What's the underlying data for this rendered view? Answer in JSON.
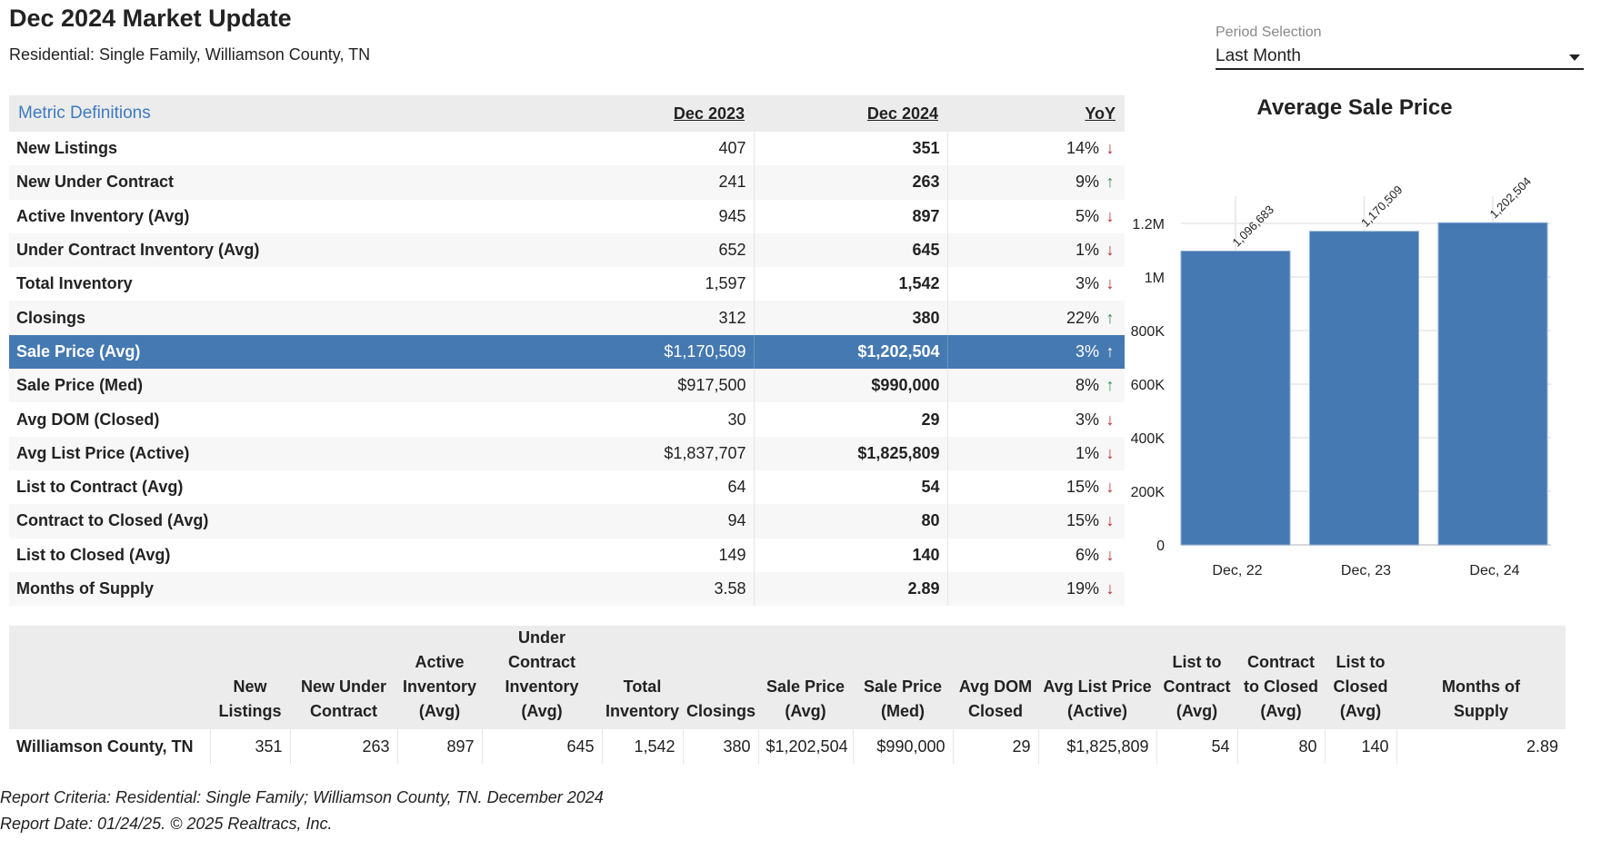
{
  "header": {
    "title": "Dec 2024 Market Update",
    "subtitle": "Residential: Single Family, Williamson County, TN"
  },
  "period_selection": {
    "label": "Period Selection",
    "value": "Last Month"
  },
  "metrics_table": {
    "definitions_link": "Metric Definitions",
    "columns": [
      "Dec 2023",
      "Dec 2024",
      "YoY"
    ],
    "selected_row": 6,
    "rows": [
      {
        "name": "New Listings",
        "prev": "407",
        "curr": "351",
        "yoy": "14%",
        "dir": "down"
      },
      {
        "name": "New Under Contract",
        "prev": "241",
        "curr": "263",
        "yoy": "9%",
        "dir": "up"
      },
      {
        "name": "Active Inventory (Avg)",
        "prev": "945",
        "curr": "897",
        "yoy": "5%",
        "dir": "down"
      },
      {
        "name": "Under Contract Inventory (Avg)",
        "prev": "652",
        "curr": "645",
        "yoy": "1%",
        "dir": "down"
      },
      {
        "name": "Total Inventory",
        "prev": "1,597",
        "curr": "1,542",
        "yoy": "3%",
        "dir": "down"
      },
      {
        "name": "Closings",
        "prev": "312",
        "curr": "380",
        "yoy": "22%",
        "dir": "up"
      },
      {
        "name": "Sale Price (Avg)",
        "prev": "$1,170,509",
        "curr": "$1,202,504",
        "yoy": "3%",
        "dir": "up"
      },
      {
        "name": "Sale Price (Med)",
        "prev": "$917,500",
        "curr": "$990,000",
        "yoy": "8%",
        "dir": "up"
      },
      {
        "name": "Avg DOM (Closed)",
        "prev": "30",
        "curr": "29",
        "yoy": "3%",
        "dir": "down"
      },
      {
        "name": "Avg List Price (Active)",
        "prev": "$1,837,707",
        "curr": "$1,825,809",
        "yoy": "1%",
        "dir": "down"
      },
      {
        "name": "List to Contract (Avg)",
        "prev": "64",
        "curr": "54",
        "yoy": "15%",
        "dir": "down"
      },
      {
        "name": "Contract to Closed (Avg)",
        "prev": "94",
        "curr": "80",
        "yoy": "15%",
        "dir": "down"
      },
      {
        "name": "List to Closed (Avg)",
        "prev": "149",
        "curr": "140",
        "yoy": "6%",
        "dir": "down"
      },
      {
        "name": "Months of Supply",
        "prev": "3.58",
        "curr": "2.89",
        "yoy": "19%",
        "dir": "down"
      }
    ],
    "icons": {
      "up": "↑",
      "down": "↓"
    },
    "colors": {
      "up": "#2e8b4a",
      "down": "#b5262b",
      "selected": "#4579b1"
    }
  },
  "chart_data": {
    "type": "bar",
    "title": "Average Sale Price",
    "categories": [
      "Dec, 22",
      "Dec, 23",
      "Dec, 24"
    ],
    "values": [
      1096683,
      1170509,
      1202504
    ],
    "data_labels": [
      "1,096,683",
      "1,170,509",
      "1,202,504"
    ],
    "ylim": [
      0,
      1200000
    ],
    "yticks": [
      0,
      200000,
      400000,
      600000,
      800000,
      1000000,
      1200000
    ],
    "ytick_labels": [
      "0",
      "200K",
      "400K",
      "600K",
      "800K",
      "1M",
      "1.2M"
    ],
    "xlabel": "",
    "ylabel": "",
    "grid": true,
    "color": "#4579b1"
  },
  "summary_table": {
    "headers": [
      "",
      "New Listings",
      "New Under Contract",
      "Active Inventory (Avg)",
      "Under Contract Inventory (Avg)",
      "Total Inventory",
      "Closings",
      "Sale Price (Avg)",
      "Sale Price (Med)",
      "Avg DOM Closed",
      "Avg List Price (Active)",
      "List to Contract (Avg)",
      "Contract to Closed (Avg)",
      "List to Closed (Avg)",
      "Months of Supply"
    ],
    "rows": [
      [
        "Williamson County, TN",
        "351",
        "263",
        "897",
        "645",
        "1,542",
        "380",
        "$1,202,504",
        "$990,000",
        "29",
        "$1,825,809",
        "54",
        "80",
        "140",
        "2.89"
      ]
    ]
  },
  "footer": {
    "criteria": "Report Criteria: Residential: Single Family; Williamson County, TN. December 2024",
    "date": "Report Date: 01/24/25. © 2025 Realtracs, Inc."
  }
}
